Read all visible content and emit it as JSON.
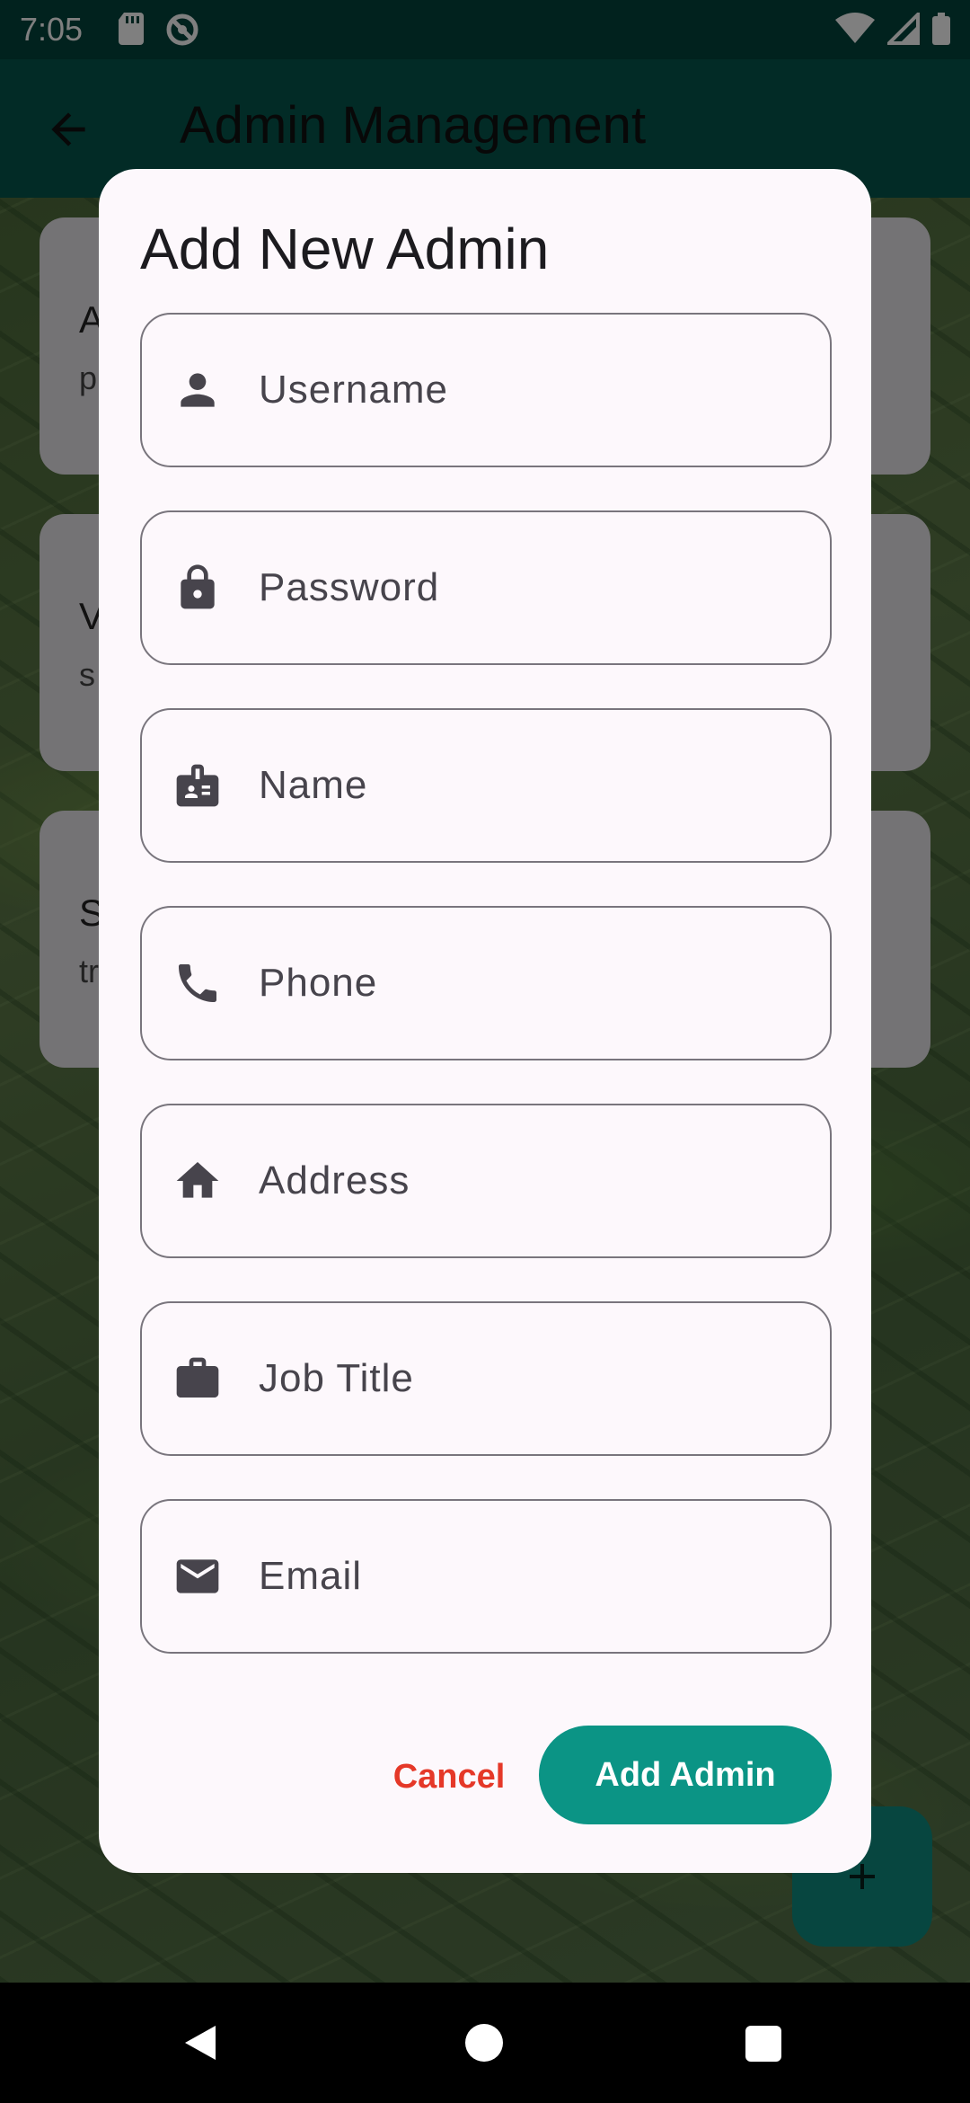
{
  "status_bar": {
    "time": "7:05"
  },
  "app_bar": {
    "title": "Admin Management"
  },
  "background_cards": [
    {
      "title": "A",
      "subtitle": "p"
    },
    {
      "title": "V",
      "subtitle": "s"
    },
    {
      "title": "S",
      "subtitle": "tr"
    }
  ],
  "dialog": {
    "title": "Add New Admin",
    "fields": [
      {
        "placeholder": "Username",
        "value": "",
        "icon": "person-icon"
      },
      {
        "placeholder": "Password",
        "value": "",
        "icon": "lock-icon"
      },
      {
        "placeholder": "Name",
        "value": "",
        "icon": "badge-icon"
      },
      {
        "placeholder": "Phone",
        "value": "",
        "icon": "phone-icon"
      },
      {
        "placeholder": "Address",
        "value": "",
        "icon": "home-icon"
      },
      {
        "placeholder": "Job Title",
        "value": "",
        "icon": "briefcase-icon"
      },
      {
        "placeholder": "Email",
        "value": "",
        "icon": "mail-icon"
      }
    ],
    "cancel_label": "Cancel",
    "submit_label": "Add Admin"
  },
  "colors": {
    "app_bar": "#04574c",
    "status_bar": "#03443c",
    "accent_button": "#0b9485",
    "cancel_text": "#e53828",
    "dialog_bg": "#fdf8fc"
  }
}
